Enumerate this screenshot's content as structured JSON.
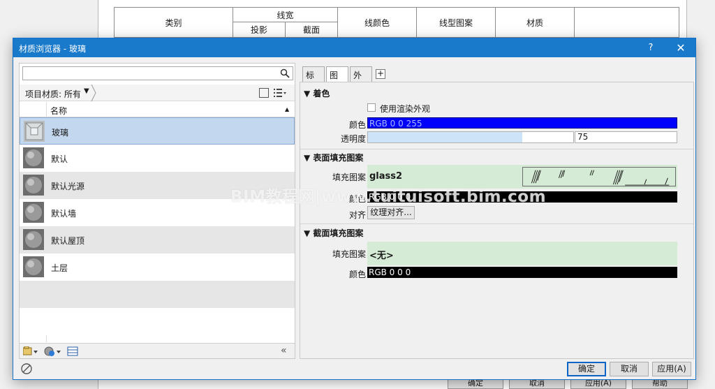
{
  "background_table": {
    "col_category": "类别",
    "col_lineweight": "线宽",
    "col_projection": "投影",
    "col_cut": "截面",
    "col_line_color": "线颜色",
    "col_line_pattern": "线型图案",
    "col_material": "材质"
  },
  "background_footer": [
    "确定",
    "取消",
    "应用(A)",
    "帮助"
  ],
  "dialog": {
    "title": "材质浏览器 - 玻璃",
    "help": "?",
    "close": "✕"
  },
  "left": {
    "search_placeholder": "",
    "filter_label": "项目材质: 所有",
    "list_header": "名称",
    "materials": [
      {
        "name": "玻璃",
        "selected": true
      },
      {
        "name": "默认",
        "selected": false
      },
      {
        "name": "默认光源",
        "selected": false
      },
      {
        "name": "默认墙",
        "selected": false
      },
      {
        "name": "默认屋顶",
        "selected": false
      },
      {
        "name": "土层",
        "selected": false
      }
    ],
    "collapse": "«"
  },
  "tabs": [
    {
      "label": "标识",
      "active": false
    },
    {
      "label": "图形",
      "active": true
    },
    {
      "label": "外观",
      "active": false
    }
  ],
  "tab_add": "+",
  "shading": {
    "title": "▼ 着色",
    "use_render_label": "使用渲染外观",
    "use_render_checked": false,
    "color_label": "颜色",
    "color_value": "RGB 0 0 255",
    "color_hex": "#0000ff",
    "transparency_label": "透明度",
    "transparency_value": "75",
    "transparency_fraction": 0.75
  },
  "surface": {
    "title": "▼ 表面填充图案",
    "pattern_label": "填充图案",
    "pattern_value": "glass2",
    "color_label": "颜色",
    "color_value": "RGB 0 0 0",
    "align_label": "对齐",
    "align_button": "纹理对齐..."
  },
  "cut": {
    "title": "▼ 截面填充图案",
    "pattern_label": "填充图案",
    "pattern_value": "<无>",
    "color_label": "颜色",
    "color_value": "RGB 0 0 0"
  },
  "footer": {
    "ok": "确定",
    "cancel": "取消",
    "apply": "应用(A)"
  },
  "watermark": "BIM教程网|www.tuituisoft.bim.com"
}
